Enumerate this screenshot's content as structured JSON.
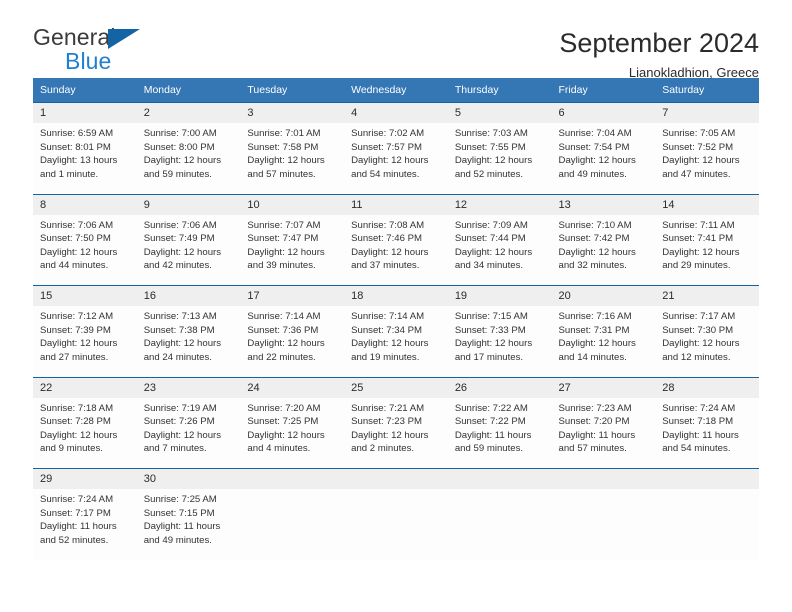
{
  "brand": {
    "name_dark": "General",
    "name_blue": "Blue",
    "accent_color": "#1464a5",
    "blue_text_color": "#1f7fd0"
  },
  "header": {
    "title": "September 2024",
    "subtitle": "Lianokladhion, Greece"
  },
  "theme": {
    "header_row_bg": "#3576b5",
    "date_band_bg": "#efefef",
    "row_divider": "#1464a5",
    "cell_bg": "#fdfdfd"
  },
  "weekdays": [
    "Sunday",
    "Monday",
    "Tuesday",
    "Wednesday",
    "Thursday",
    "Friday",
    "Saturday"
  ],
  "weeks": [
    {
      "dates": [
        "1",
        "2",
        "3",
        "4",
        "5",
        "6",
        "7"
      ],
      "cells": [
        {
          "sunrise": "Sunrise: 6:59 AM",
          "sunset": "Sunset: 8:01 PM",
          "daylight_line1": "Daylight: 13 hours",
          "daylight_line2": "and 1 minute."
        },
        {
          "sunrise": "Sunrise: 7:00 AM",
          "sunset": "Sunset: 8:00 PM",
          "daylight_line1": "Daylight: 12 hours",
          "daylight_line2": "and 59 minutes."
        },
        {
          "sunrise": "Sunrise: 7:01 AM",
          "sunset": "Sunset: 7:58 PM",
          "daylight_line1": "Daylight: 12 hours",
          "daylight_line2": "and 57 minutes."
        },
        {
          "sunrise": "Sunrise: 7:02 AM",
          "sunset": "Sunset: 7:57 PM",
          "daylight_line1": "Daylight: 12 hours",
          "daylight_line2": "and 54 minutes."
        },
        {
          "sunrise": "Sunrise: 7:03 AM",
          "sunset": "Sunset: 7:55 PM",
          "daylight_line1": "Daylight: 12 hours",
          "daylight_line2": "and 52 minutes."
        },
        {
          "sunrise": "Sunrise: 7:04 AM",
          "sunset": "Sunset: 7:54 PM",
          "daylight_line1": "Daylight: 12 hours",
          "daylight_line2": "and 49 minutes."
        },
        {
          "sunrise": "Sunrise: 7:05 AM",
          "sunset": "Sunset: 7:52 PM",
          "daylight_line1": "Daylight: 12 hours",
          "daylight_line2": "and 47 minutes."
        }
      ]
    },
    {
      "dates": [
        "8",
        "9",
        "10",
        "11",
        "12",
        "13",
        "14"
      ],
      "cells": [
        {
          "sunrise": "Sunrise: 7:06 AM",
          "sunset": "Sunset: 7:50 PM",
          "daylight_line1": "Daylight: 12 hours",
          "daylight_line2": "and 44 minutes."
        },
        {
          "sunrise": "Sunrise: 7:06 AM",
          "sunset": "Sunset: 7:49 PM",
          "daylight_line1": "Daylight: 12 hours",
          "daylight_line2": "and 42 minutes."
        },
        {
          "sunrise": "Sunrise: 7:07 AM",
          "sunset": "Sunset: 7:47 PM",
          "daylight_line1": "Daylight: 12 hours",
          "daylight_line2": "and 39 minutes."
        },
        {
          "sunrise": "Sunrise: 7:08 AM",
          "sunset": "Sunset: 7:46 PM",
          "daylight_line1": "Daylight: 12 hours",
          "daylight_line2": "and 37 minutes."
        },
        {
          "sunrise": "Sunrise: 7:09 AM",
          "sunset": "Sunset: 7:44 PM",
          "daylight_line1": "Daylight: 12 hours",
          "daylight_line2": "and 34 minutes."
        },
        {
          "sunrise": "Sunrise: 7:10 AM",
          "sunset": "Sunset: 7:42 PM",
          "daylight_line1": "Daylight: 12 hours",
          "daylight_line2": "and 32 minutes."
        },
        {
          "sunrise": "Sunrise: 7:11 AM",
          "sunset": "Sunset: 7:41 PM",
          "daylight_line1": "Daylight: 12 hours",
          "daylight_line2": "and 29 minutes."
        }
      ]
    },
    {
      "dates": [
        "15",
        "16",
        "17",
        "18",
        "19",
        "20",
        "21"
      ],
      "cells": [
        {
          "sunrise": "Sunrise: 7:12 AM",
          "sunset": "Sunset: 7:39 PM",
          "daylight_line1": "Daylight: 12 hours",
          "daylight_line2": "and 27 minutes."
        },
        {
          "sunrise": "Sunrise: 7:13 AM",
          "sunset": "Sunset: 7:38 PM",
          "daylight_line1": "Daylight: 12 hours",
          "daylight_line2": "and 24 minutes."
        },
        {
          "sunrise": "Sunrise: 7:14 AM",
          "sunset": "Sunset: 7:36 PM",
          "daylight_line1": "Daylight: 12 hours",
          "daylight_line2": "and 22 minutes."
        },
        {
          "sunrise": "Sunrise: 7:14 AM",
          "sunset": "Sunset: 7:34 PM",
          "daylight_line1": "Daylight: 12 hours",
          "daylight_line2": "and 19 minutes."
        },
        {
          "sunrise": "Sunrise: 7:15 AM",
          "sunset": "Sunset: 7:33 PM",
          "daylight_line1": "Daylight: 12 hours",
          "daylight_line2": "and 17 minutes."
        },
        {
          "sunrise": "Sunrise: 7:16 AM",
          "sunset": "Sunset: 7:31 PM",
          "daylight_line1": "Daylight: 12 hours",
          "daylight_line2": "and 14 minutes."
        },
        {
          "sunrise": "Sunrise: 7:17 AM",
          "sunset": "Sunset: 7:30 PM",
          "daylight_line1": "Daylight: 12 hours",
          "daylight_line2": "and 12 minutes."
        }
      ]
    },
    {
      "dates": [
        "22",
        "23",
        "24",
        "25",
        "26",
        "27",
        "28"
      ],
      "cells": [
        {
          "sunrise": "Sunrise: 7:18 AM",
          "sunset": "Sunset: 7:28 PM",
          "daylight_line1": "Daylight: 12 hours",
          "daylight_line2": "and 9 minutes."
        },
        {
          "sunrise": "Sunrise: 7:19 AM",
          "sunset": "Sunset: 7:26 PM",
          "daylight_line1": "Daylight: 12 hours",
          "daylight_line2": "and 7 minutes."
        },
        {
          "sunrise": "Sunrise: 7:20 AM",
          "sunset": "Sunset: 7:25 PM",
          "daylight_line1": "Daylight: 12 hours",
          "daylight_line2": "and 4 minutes."
        },
        {
          "sunrise": "Sunrise: 7:21 AM",
          "sunset": "Sunset: 7:23 PM",
          "daylight_line1": "Daylight: 12 hours",
          "daylight_line2": "and 2 minutes."
        },
        {
          "sunrise": "Sunrise: 7:22 AM",
          "sunset": "Sunset: 7:22 PM",
          "daylight_line1": "Daylight: 11 hours",
          "daylight_line2": "and 59 minutes."
        },
        {
          "sunrise": "Sunrise: 7:23 AM",
          "sunset": "Sunset: 7:20 PM",
          "daylight_line1": "Daylight: 11 hours",
          "daylight_line2": "and 57 minutes."
        },
        {
          "sunrise": "Sunrise: 7:24 AM",
          "sunset": "Sunset: 7:18 PM",
          "daylight_line1": "Daylight: 11 hours",
          "daylight_line2": "and 54 minutes."
        }
      ]
    },
    {
      "dates": [
        "29",
        "30",
        "",
        "",
        "",
        "",
        ""
      ],
      "cells": [
        {
          "sunrise": "Sunrise: 7:24 AM",
          "sunset": "Sunset: 7:17 PM",
          "daylight_line1": "Daylight: 11 hours",
          "daylight_line2": "and 52 minutes."
        },
        {
          "sunrise": "Sunrise: 7:25 AM",
          "sunset": "Sunset: 7:15 PM",
          "daylight_line1": "Daylight: 11 hours",
          "daylight_line2": "and 49 minutes."
        },
        {
          "sunrise": "",
          "sunset": "",
          "daylight_line1": "",
          "daylight_line2": ""
        },
        {
          "sunrise": "",
          "sunset": "",
          "daylight_line1": "",
          "daylight_line2": ""
        },
        {
          "sunrise": "",
          "sunset": "",
          "daylight_line1": "",
          "daylight_line2": ""
        },
        {
          "sunrise": "",
          "sunset": "",
          "daylight_line1": "",
          "daylight_line2": ""
        },
        {
          "sunrise": "",
          "sunset": "",
          "daylight_line1": "",
          "daylight_line2": ""
        }
      ]
    }
  ]
}
